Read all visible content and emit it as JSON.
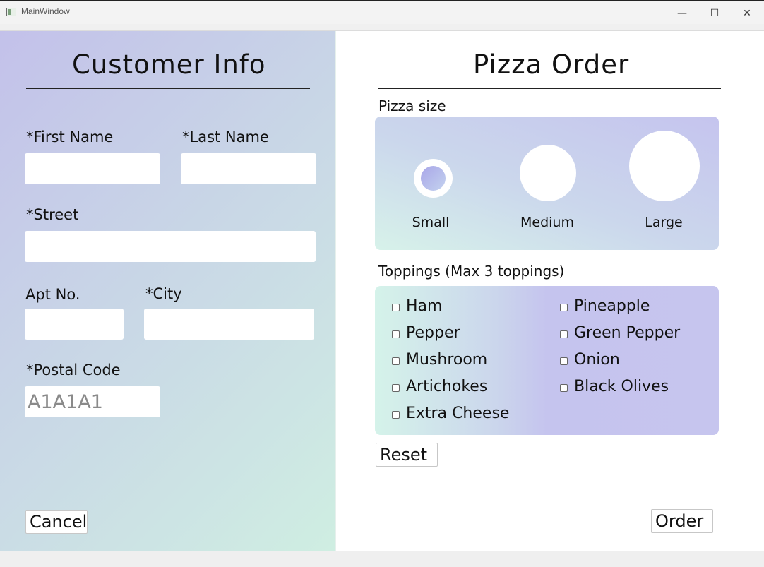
{
  "window": {
    "title": "MainWindow",
    "minimize": "—",
    "maximize": "☐",
    "close": "✕"
  },
  "customer": {
    "heading": "Customer Info",
    "first_name_label": "*First Name",
    "first_name_value": "",
    "last_name_label": "*Last Name",
    "last_name_value": "",
    "street_label": "*Street",
    "street_value": "",
    "apt_label": "Apt No.",
    "apt_value": "",
    "city_label": "*City",
    "city_value": "",
    "postal_label": "*Postal Code",
    "postal_placeholder": "A1A1A1",
    "postal_value": "",
    "cancel_label": "Cancel"
  },
  "order": {
    "heading": "Pizza Order",
    "size_label": "Pizza size",
    "sizes": [
      {
        "label": "Small",
        "selected": true
      },
      {
        "label": "Medium",
        "selected": false
      },
      {
        "label": "Large",
        "selected": false
      }
    ],
    "toppings_label": "Toppings (Max 3 toppings)",
    "toppings_left": [
      {
        "label": "Ham",
        "checked": false
      },
      {
        "label": "Pepper",
        "checked": false
      },
      {
        "label": "Mushroom",
        "checked": false
      },
      {
        "label": "Artichokes",
        "checked": false
      },
      {
        "label": "Extra Cheese",
        "checked": false
      }
    ],
    "toppings_right": [
      {
        "label": "Pineapple",
        "checked": false
      },
      {
        "label": "Green Pepper",
        "checked": false
      },
      {
        "label": "Onion",
        "checked": false
      },
      {
        "label": "Black Olives",
        "checked": false
      }
    ],
    "reset_label": "Reset",
    "order_label": "Order"
  },
  "colors": {
    "left_gradient_start": "#c3c1ea",
    "left_gradient_end": "#cfeee2",
    "panel_lavender": "#c5c4ee",
    "panel_mint": "#d7f2ea"
  }
}
